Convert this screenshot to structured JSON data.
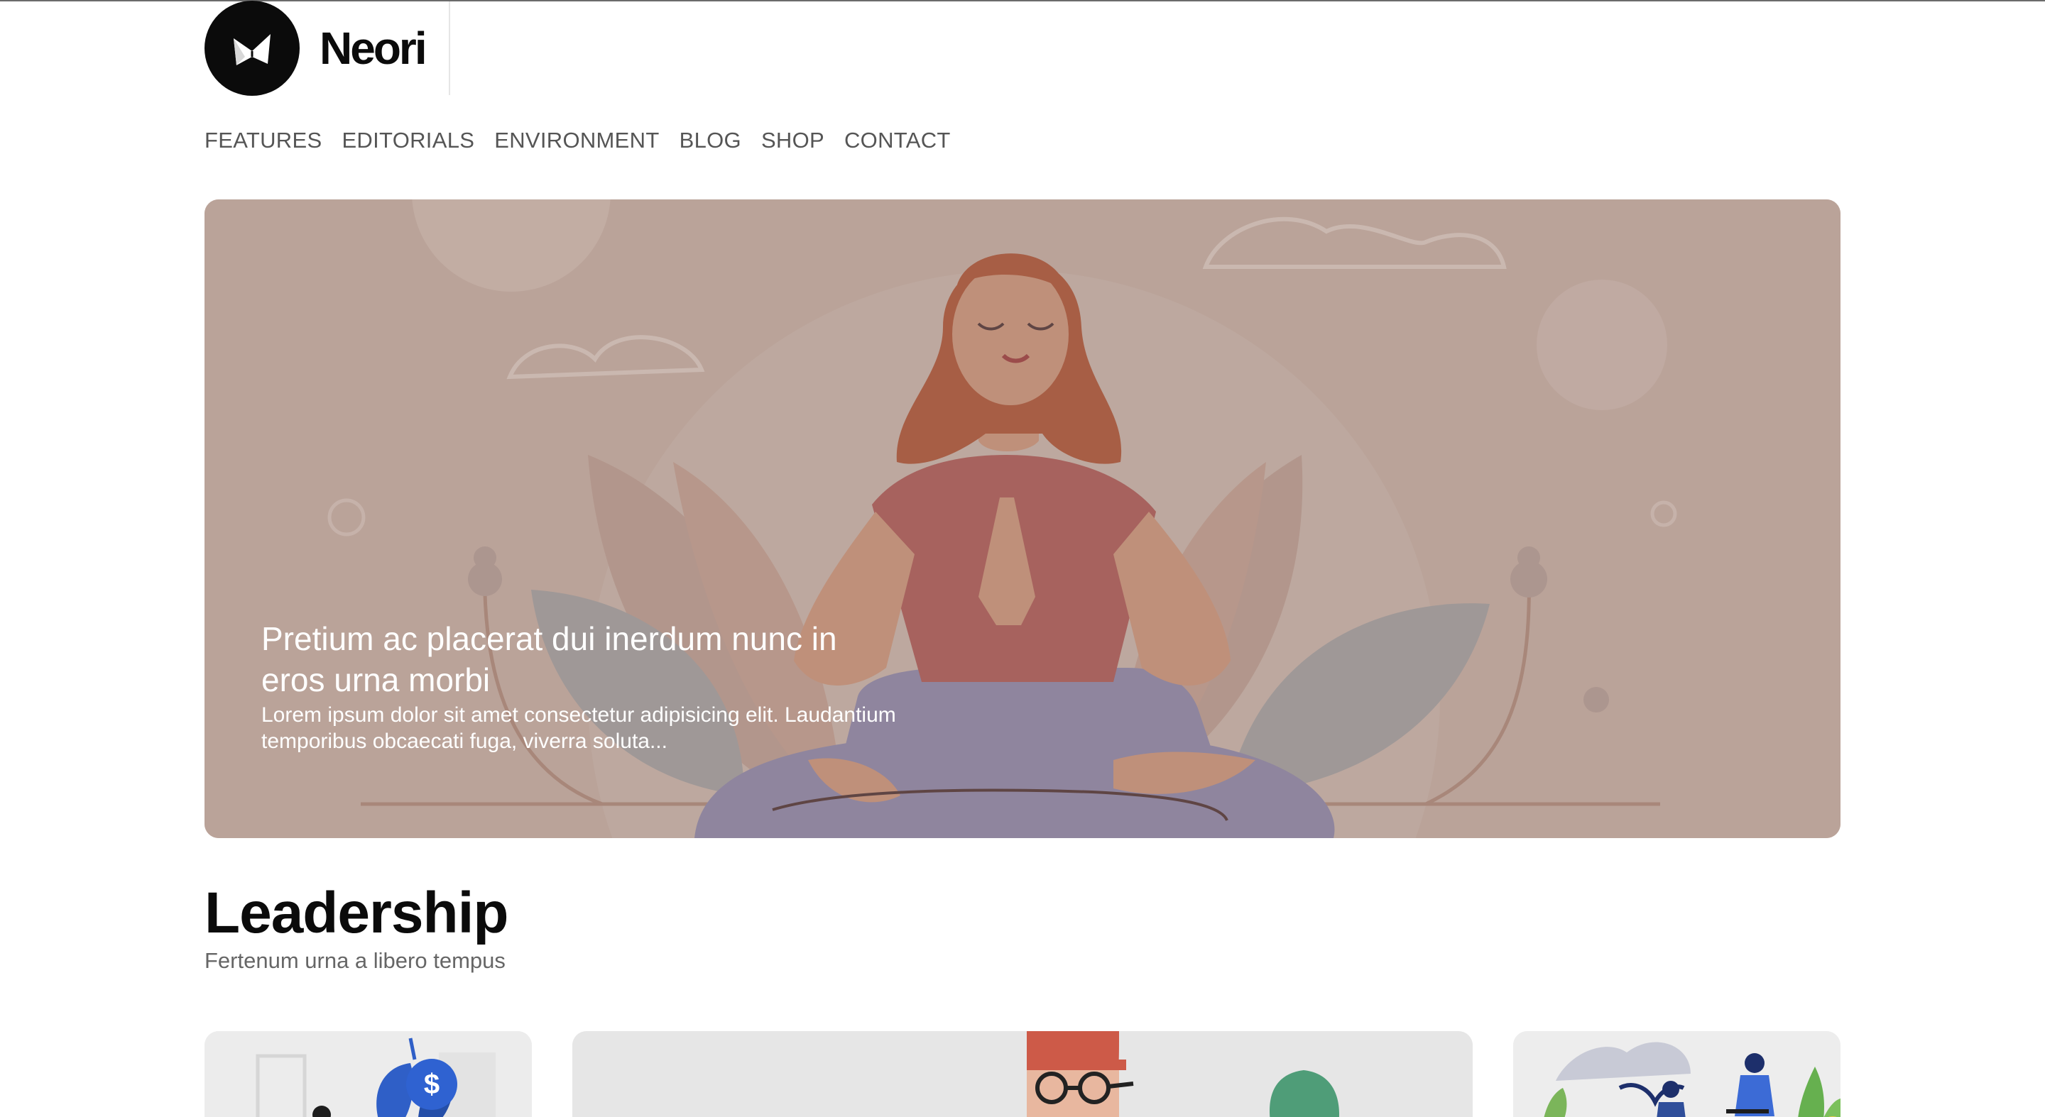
{
  "brand": {
    "name": "Neori"
  },
  "nav": {
    "items": [
      {
        "label": "FEATURES"
      },
      {
        "label": "EDITORIALS"
      },
      {
        "label": "ENVIRONMENT"
      },
      {
        "label": "BLOG"
      },
      {
        "label": "SHOP"
      },
      {
        "label": "CONTACT"
      }
    ]
  },
  "hero": {
    "title": "Pretium ac placerat dui inerdum nunc in eros urna morbi",
    "excerpt": "Lorem ipsum dolor sit amet consectetur adipisicing elit. Laudantium temporibus obcaecati fuga, viverra soluta...",
    "image_icon": "meditation-illustration"
  },
  "section": {
    "title": "Leadership",
    "subtitle": "Fertenum urna a libero tempus"
  },
  "cards": [
    {
      "image_icon": "plant-money-illustration"
    },
    {
      "image_icon": "person-glasses-illustration"
    },
    {
      "image_icon": "team-celebration-illustration"
    }
  ],
  "colors": {
    "hero_bg": "#c9b1a6",
    "card_bg": "#ececec",
    "nav_text": "#555555",
    "brand": "#0b0b0b"
  }
}
